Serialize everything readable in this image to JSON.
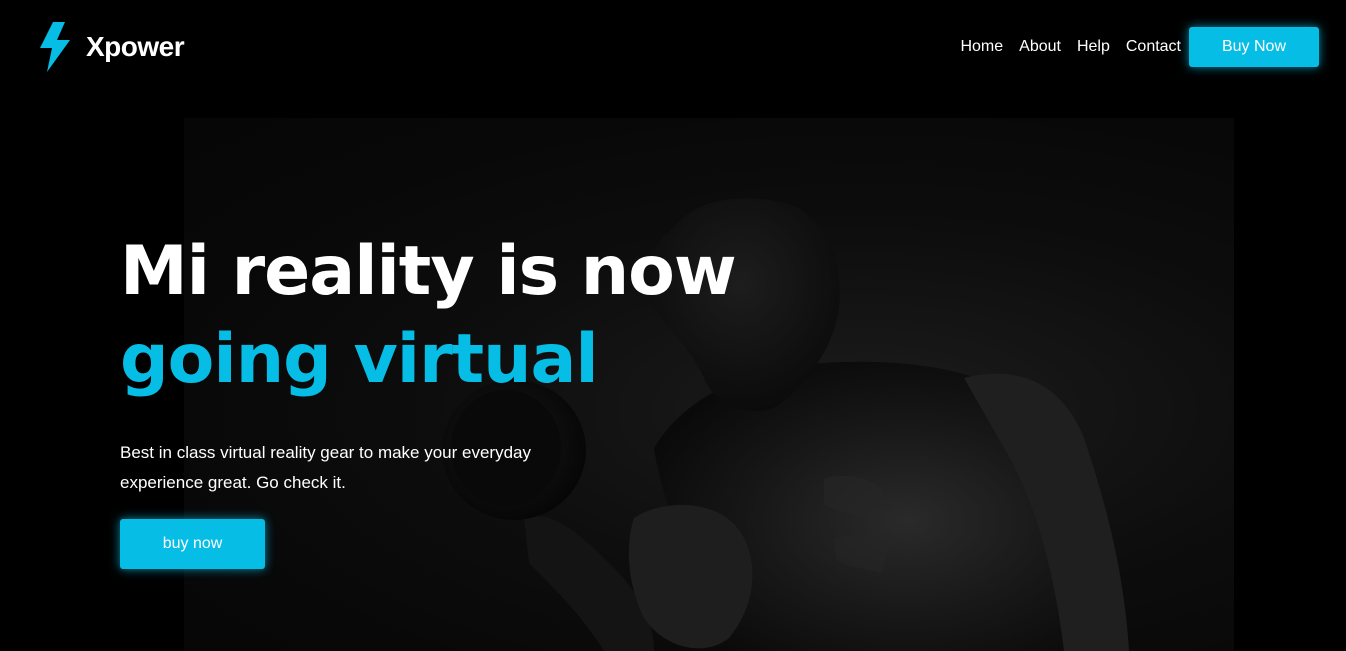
{
  "header": {
    "logo_text": "Xpower",
    "logo_icon": "lightning-bolt-icon",
    "nav": [
      {
        "label": "Home"
      },
      {
        "label": "About"
      },
      {
        "label": "Help"
      },
      {
        "label": "Contact"
      }
    ],
    "cta_label": "Buy Now"
  },
  "hero": {
    "title_line1": "Mi reality is now",
    "title_line2": "going virtual",
    "description": "Best in class virtual reality gear to make your everyday experience great. Go check it.",
    "cta_label": "buy now",
    "image_description_icon": "athlete-with-dumbbell-photo"
  },
  "colors": {
    "accent": "#06bde5",
    "background": "#000000",
    "text": "#ffffff"
  }
}
